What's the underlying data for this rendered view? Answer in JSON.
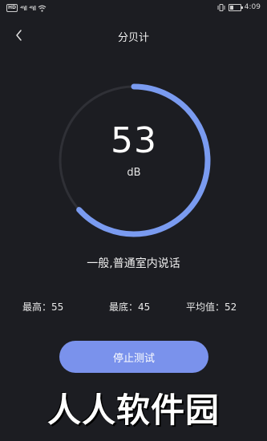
{
  "status_bar": {
    "hd_badge": "HD",
    "signal_1": "⁴⁶ıll",
    "signal_2": "⁴⁶ıll",
    "time": "4:09",
    "battery_level": 0.35
  },
  "header": {
    "title": "分贝计"
  },
  "meter": {
    "value": "53",
    "unit": "dB",
    "colors": {
      "track": "#2f3036",
      "progress": "#7a9bf0"
    }
  },
  "description": "一般,普通室内说话",
  "stats": {
    "max": "最高：55",
    "min": "最底：45",
    "avg": "平均值：52"
  },
  "stop_button": "停止测试",
  "watermark": "人人软件园",
  "colors": {
    "background": "#1c1d22",
    "accent": "#7a92ec"
  }
}
